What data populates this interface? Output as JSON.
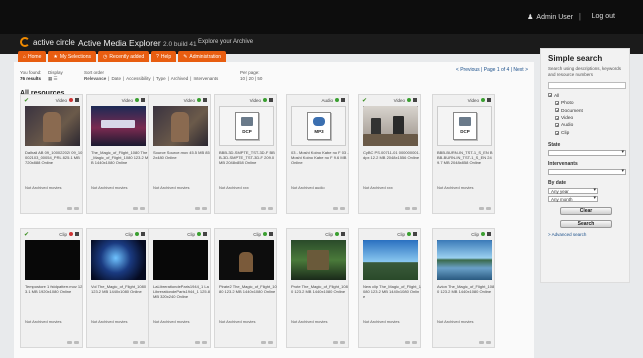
{
  "topbar": {
    "user": "Admin User",
    "separator": "|",
    "logout": "Log out"
  },
  "header": {
    "logo_text": "active circle",
    "app_title": "Active Media Explorer",
    "build": "2.0 build 41",
    "explore": "Explore your Archive"
  },
  "tabs": [
    {
      "label": "Home",
      "icon": "home-icon"
    },
    {
      "label": "My Selections",
      "icon": "star-icon"
    },
    {
      "label": "Recently added",
      "icon": "clock-icon"
    },
    {
      "label": "Help",
      "icon": "help-icon"
    },
    {
      "label": "Administration",
      "icon": "wrench-icon"
    }
  ],
  "controls": {
    "you_found": "You found:",
    "found_count": "76 results",
    "display": "Display",
    "sort_order": "Sort order",
    "sort_options": [
      "Relevance",
      "Date",
      "Accessibility",
      "Type",
      "Archived",
      "Intervenants"
    ],
    "per_page": "Per page:",
    "per_page_options": "10 | 20 | 50"
  },
  "pager": {
    "prev": "< Previous",
    "text": "| Page 1 of 4 |",
    "next": "Next >"
  },
  "section_title": "All resources",
  "cards": [
    {
      "type": "Video",
      "checked": true,
      "dot": "#cc3333",
      "thumb": "dark",
      "info": "Dalhali AB 09_10002202/ 09_10002103_00054_PRL 825.1 MB 720x888 Online",
      "status": "Not Archived movies"
    },
    {
      "type": "Video",
      "checked": false,
      "dot": "#3a9f30",
      "thumb": "movie",
      "info": "The_Magic_of_Flight_1080 The_Magic_of_Flight_1080 123.2 MB 1440x1080 Online",
      "status": "Not Archived movies"
    },
    {
      "type": "Video",
      "checked": false,
      "dot": "#3a9f30",
      "thumb": "dark",
      "info": "Source Source.mov 45.5 MB 852x480 Online",
      "status": "Not Archived movies"
    },
    {
      "type": "Video",
      "checked": false,
      "dot": "#3a9f30",
      "thumb": "dcp",
      "doc_label": "DCP",
      "info": "BBB-3D-SMPTE_TST-3D-F BBB-3D-SMPTE_TST-3D-F 209.0 MB 2048x858 Online",
      "status": "Not Archived xxx"
    },
    {
      "type": "Audio",
      "checked": false,
      "dot": "#3a9f30",
      "thumb": "mp3",
      "doc_label": "MP3",
      "info": "03 - Moshi Koino Kabe no F 03 - Moshi Koino Kabe no F 9.6 MB Online",
      "status": "Not Archived audio"
    },
    {
      "type": "Video",
      "checked": true,
      "dot": "#3a9f30",
      "thumb": "meeting",
      "info": "CyBC PS.00711-01 000000001.dpx 12.2 MB 2048x1556 Online",
      "status": "Not Archived xxx"
    },
    {
      "type": "Video",
      "checked": false,
      "dot": "#3a9f30",
      "thumb": "dcp",
      "doc_label": "DCP",
      "info": "BBB-BURN-IN_TST-1_S_EN BBB-BURN-IN_TST-1_S_EN 249.7 MB 2048x858 Online",
      "status": "Not Archived movies"
    },
    {
      "type": "Clip",
      "checked": true,
      "dot": "#cc3333",
      "thumb": "black",
      "info": "Tempostore 1 fstdpatterr.mov 123.1 MB 1920x1080 Online",
      "status": "Not Archived movies"
    },
    {
      "type": "Clip",
      "checked": false,
      "dot": "#3a9f30",
      "thumb": "cosmic",
      "info": "Vol The_Magic_of_Flight_1080 123.2 MB 1440x1080 Online",
      "status": "Not Archived movies"
    },
    {
      "type": "Clip",
      "checked": false,
      "dot": "#3a9f30",
      "thumb": "black",
      "info": "LaLibrerationdeParis1944_1 LaLibrerationdeParis1944_1 125.8 MB 320x240 Online",
      "status": "Not Archived movies"
    },
    {
      "type": "Clip",
      "checked": false,
      "dot": "#3a9f30",
      "thumb": "night",
      "info": "Pirate2 The_Magic_of_Flight_1080 123.2 MB 1440x1080 Online",
      "status": "Not Archived movies"
    },
    {
      "type": "Clip",
      "checked": false,
      "dot": "#3a9f30",
      "thumb": "green",
      "info": "Prote The_Magic_of_Flight_1080 123.2 MB 1440x1080 Online",
      "status": "Not Archived movies"
    },
    {
      "type": "Clip",
      "checked": false,
      "dot": "#3a9f30",
      "thumb": "sky",
      "info": "New clip The_Magic_of_Flight_1080 123.2 MB 1440x1080 Online",
      "status": "Not Archived movies"
    },
    {
      "type": "Clip",
      "checked": false,
      "dot": "#3a9f30",
      "thumb": "lake",
      "info": "Avion The_Magic_of_Flight_1080 123.2 MB 1440x1080 Online",
      "status": "Not Archived movies"
    }
  ],
  "sidebar": {
    "title": "Simple search",
    "description": "Search using descriptions, keywords and resource numbers",
    "types": [
      "All",
      "Photo",
      "Document",
      "Video",
      "Audio",
      "Clip"
    ],
    "state_label": "State",
    "intervenants_label": "Intervenants",
    "by_date_label": "By date",
    "any_year": "Any year",
    "any_month": "Any month",
    "clear_label": "Clear",
    "search_label": "Search",
    "advanced": "> Advanced search"
  }
}
